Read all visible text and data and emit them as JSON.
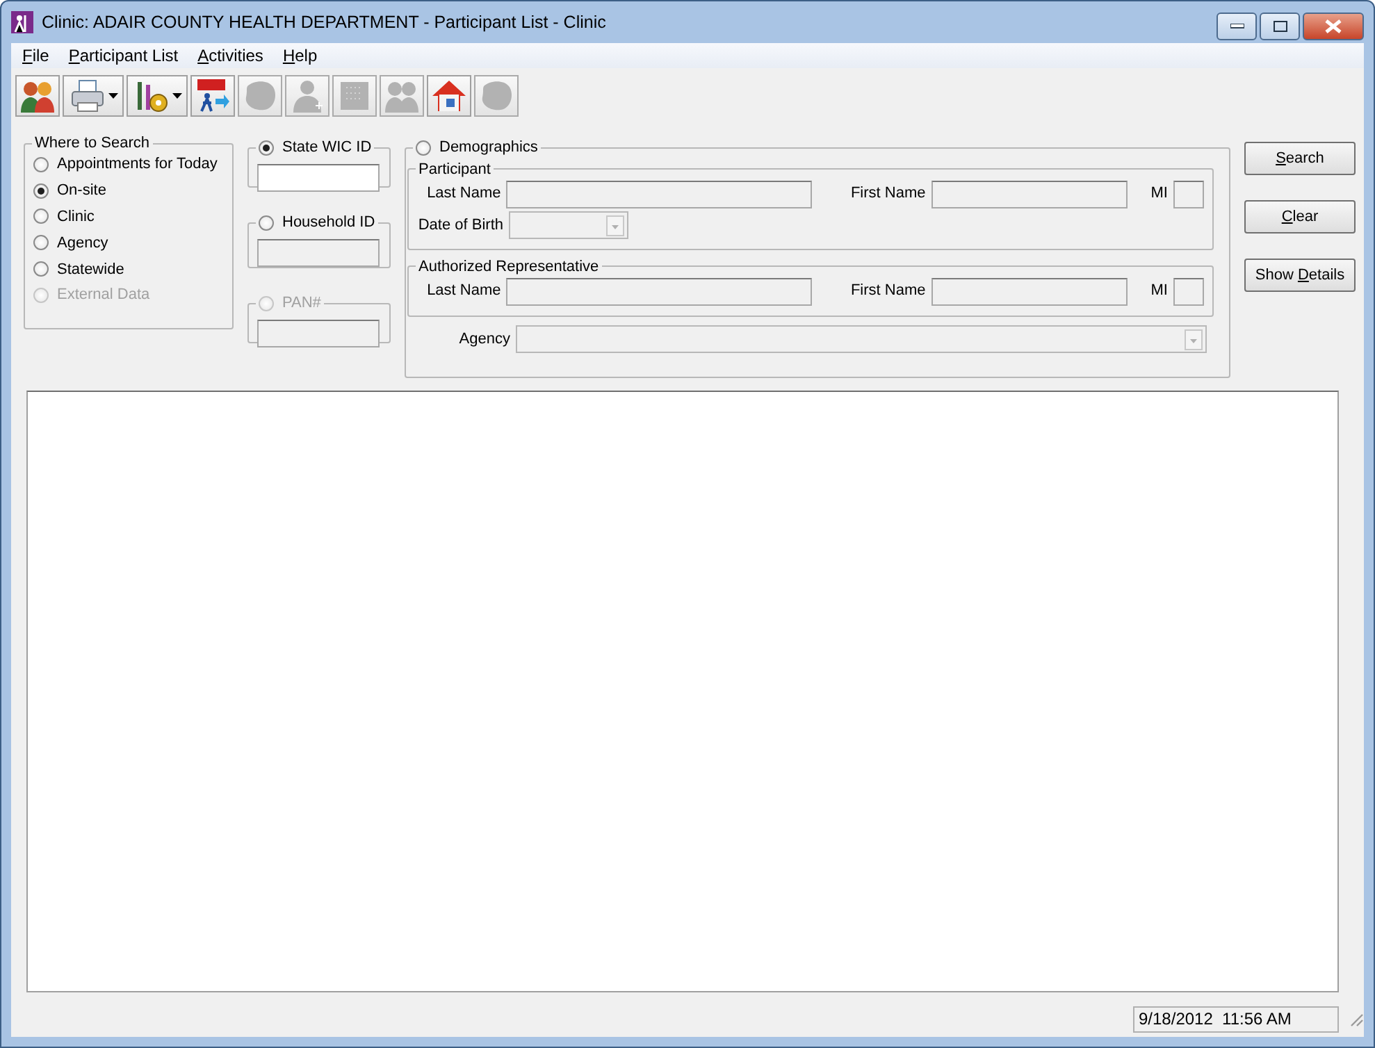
{
  "window": {
    "title": "Clinic: ADAIR COUNTY HEALTH DEPARTMENT - Participant List - Clinic"
  },
  "menu": [
    {
      "key": "F",
      "rest": "ile"
    },
    {
      "key": "P",
      "rest": "articipant List"
    },
    {
      "key": "A",
      "rest": "ctivities"
    },
    {
      "key": "H",
      "rest": "elp"
    }
  ],
  "toolbar": [
    {
      "kind": "people",
      "disabled": false,
      "dropdown": false
    },
    {
      "kind": "printer",
      "disabled": false,
      "dropdown": true
    },
    {
      "kind": "tools",
      "disabled": false,
      "dropdown": true
    },
    {
      "kind": "exit",
      "disabled": false,
      "dropdown": false
    },
    {
      "kind": "blob",
      "disabled": true,
      "dropdown": false
    },
    {
      "kind": "person",
      "disabled": true,
      "dropdown": false
    },
    {
      "kind": "grid",
      "disabled": true,
      "dropdown": false
    },
    {
      "kind": "people",
      "disabled": true,
      "dropdown": false
    },
    {
      "kind": "house",
      "disabled": false,
      "dropdown": false
    },
    {
      "kind": "blob",
      "disabled": true,
      "dropdown": false
    }
  ],
  "where_to_search": {
    "title": "Where to Search",
    "options": [
      {
        "label": "Appointments for Today",
        "selected": false,
        "disabled": false
      },
      {
        "label": "On-site",
        "selected": true,
        "disabled": false
      },
      {
        "label": "Clinic",
        "selected": false,
        "disabled": false
      },
      {
        "label": "Agency",
        "selected": false,
        "disabled": false
      },
      {
        "label": "Statewide",
        "selected": false,
        "disabled": false
      },
      {
        "label": "External Data",
        "selected": false,
        "disabled": true
      }
    ]
  },
  "id_searches": [
    {
      "label": "State WIC ID",
      "selected": true,
      "disabled": false
    },
    {
      "label": "Household ID",
      "selected": false,
      "disabled": false
    },
    {
      "label": "PAN#",
      "selected": false,
      "disabled": true
    }
  ],
  "demographics": {
    "label": "Demographics",
    "selected": false,
    "participant": {
      "title": "Participant",
      "last_name": "Last Name",
      "first_name": "First Name",
      "mi": "MI",
      "dob": "Date of Birth"
    },
    "representative": {
      "title": "Authorized Representative",
      "last_name": "Last Name",
      "first_name": "First Name",
      "mi": "MI"
    },
    "agency": "Agency"
  },
  "buttons": [
    {
      "key": "S",
      "rest": "earch"
    },
    {
      "key": "C",
      "rest": "lear"
    },
    {
      "before": "Show ",
      "key": "D",
      "rest": "etails"
    }
  ],
  "status_bar": {
    "datetime": "9/18/2012  11:56 AM"
  }
}
